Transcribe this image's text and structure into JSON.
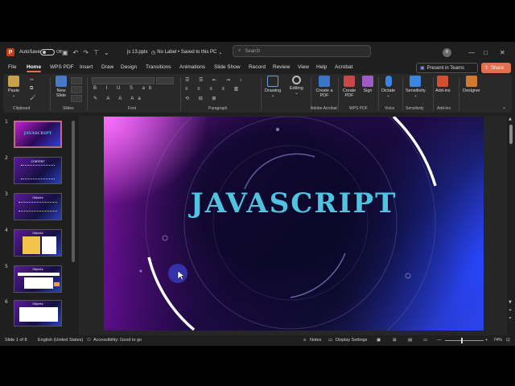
{
  "titlebar": {
    "autosave_label": "AutoSave",
    "autosave_state": "Off",
    "filename": "js 13.pptx",
    "label_status": "No Label • Saved to this PC",
    "search_placeholder": "Search",
    "user_initials": "R"
  },
  "menu": {
    "tabs": [
      "File",
      "Home",
      "WPS PDF",
      "Insert",
      "Draw",
      "Design",
      "Transitions",
      "Animations",
      "Slide Show",
      "Record",
      "Review",
      "View",
      "Help",
      "Acrobat"
    ],
    "active_tab": "Home",
    "present_label": "Present in Teams",
    "share_label": "Share"
  },
  "ribbon": {
    "paste_label": "Paste",
    "new_slide_label": "New Slide",
    "drawing_label": "Drawing",
    "editing_label": "Editing",
    "create_pdf_label": "Create a PDF",
    "create_pdf2_label": "Create PDF",
    "sign_label": "Sign",
    "dictate_label": "Dictate",
    "sensitivity_label": "Sensitivity",
    "addins_label": "Add-ins",
    "designer_label": "Designer",
    "groups": {
      "clipboard": "Clipboard",
      "slides": "Slides",
      "font": "Font",
      "paragraph": "Paragraph",
      "adobe": "Adobe Acrobat",
      "wps": "WPS PDF",
      "voice": "Voice",
      "sensitivity": "Sensitivity",
      "addins": "Add-ins"
    }
  },
  "thumbnails": [
    {
      "num": "1",
      "title": "JAVASCRIPT",
      "selected": true
    },
    {
      "num": "2",
      "title": "CONTENT"
    },
    {
      "num": "3",
      "title": "Objects"
    },
    {
      "num": "4",
      "title": "Objects"
    },
    {
      "num": "5",
      "title": "Objects"
    },
    {
      "num": "6",
      "title": "Objects"
    }
  ],
  "slide": {
    "title": "JAVASCRIPT"
  },
  "status": {
    "slide_counter": "Slide 1 of 8",
    "language": "English (United States)",
    "accessibility": "Accessibility: Good to go",
    "notes": "Notes",
    "display_settings": "Display Settings",
    "zoom": "74%"
  },
  "colors": {
    "accent": "#c43e1c",
    "share": "#e0704f",
    "title_cyan": "#4fc3e0"
  }
}
